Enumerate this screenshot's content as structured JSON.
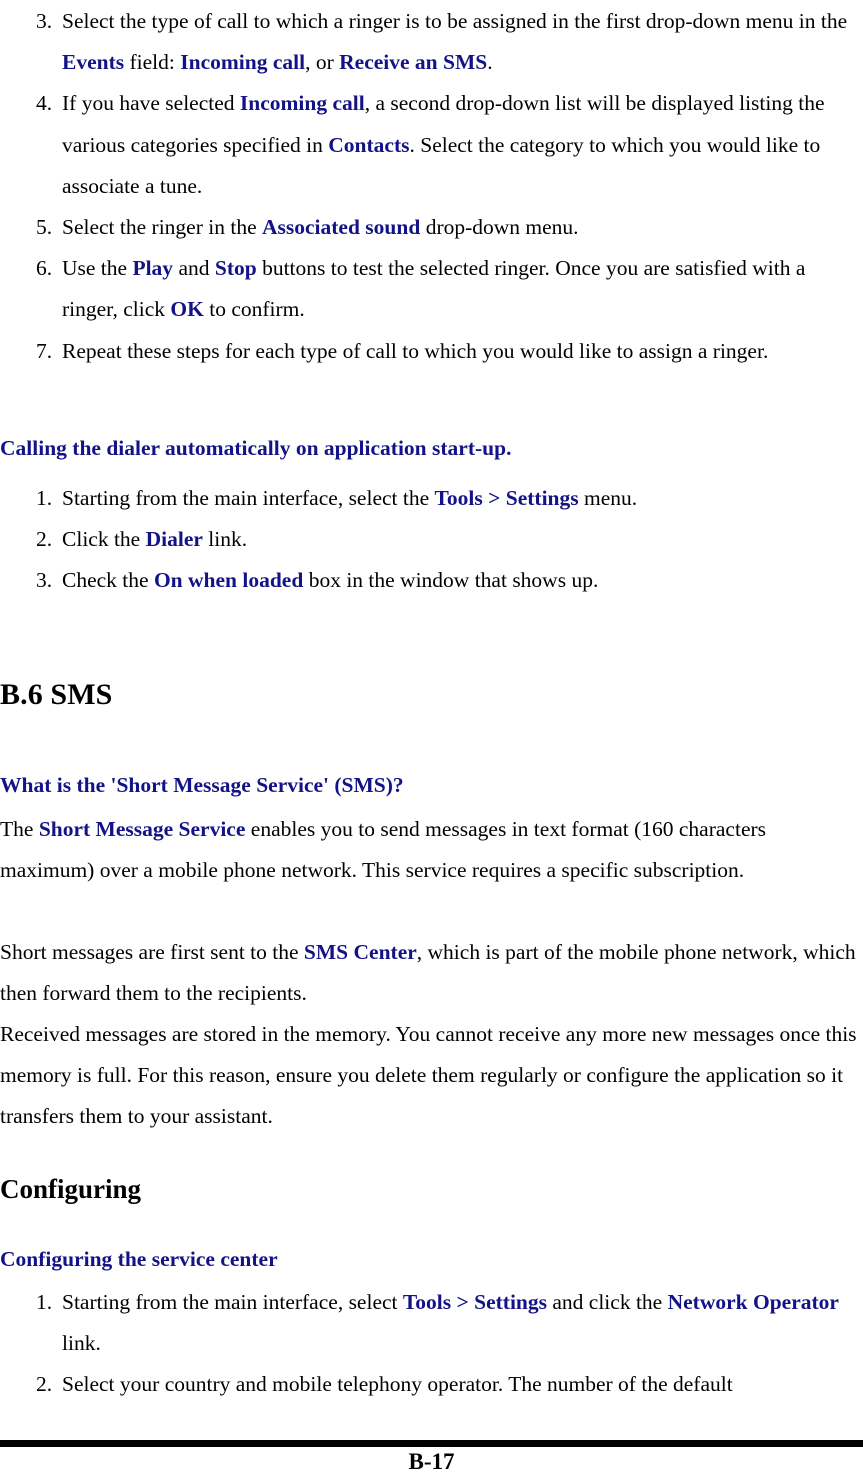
{
  "page": {
    "footer_page_number": "B-17",
    "accent_color": "#131387",
    "text_color": "#000000",
    "background_color": "#ffffff"
  },
  "ringer_steps": {
    "items": [
      {
        "number": "3.",
        "runs": [
          {
            "t": "Select the type of call to which a ringer is to be assigned in the first drop-down menu in the ",
            "s": "plain"
          },
          {
            "t": "Events",
            "s": "bold-blue"
          },
          {
            "t": " field: ",
            "s": "plain"
          },
          {
            "t": "Incoming call",
            "s": "bold-blue"
          },
          {
            "t": ", or ",
            "s": "plain"
          },
          {
            "t": "Receive an SMS",
            "s": "bold-blue"
          },
          {
            "t": ".",
            "s": "plain"
          }
        ]
      },
      {
        "number": "4.",
        "runs": [
          {
            "t": "If you have selected ",
            "s": "plain"
          },
          {
            "t": "Incoming call",
            "s": "bold-blue"
          },
          {
            "t": ", a second drop-down list will be displayed listing the various categories specified in ",
            "s": "plain"
          },
          {
            "t": "Contacts",
            "s": "bold-blue"
          },
          {
            "t": ". Select the category to which you would like to associate a tune.",
            "s": "plain"
          }
        ]
      },
      {
        "number": "5.",
        "runs": [
          {
            "t": "Select the ringer in the ",
            "s": "plain"
          },
          {
            "t": "Associated sound",
            "s": "bold-blue"
          },
          {
            "t": " drop-down menu.",
            "s": "plain"
          }
        ]
      },
      {
        "number": "6.",
        "runs": [
          {
            "t": "Use the ",
            "s": "plain"
          },
          {
            "t": "Play",
            "s": "bold-blue"
          },
          {
            "t": " and ",
            "s": "plain"
          },
          {
            "t": "Stop",
            "s": "bold-blue"
          },
          {
            "t": " buttons to test the selected ringer. Once you are satisfied with a ringer, click ",
            "s": "plain"
          },
          {
            "t": "OK",
            "s": "bold-blue"
          },
          {
            "t": " to confirm.",
            "s": "plain"
          }
        ]
      },
      {
        "number": "7.",
        "runs": [
          {
            "t": "Repeat these steps for each type of call to which you would like to assign a ringer.",
            "s": "plain"
          }
        ]
      }
    ]
  },
  "dialer_heading": {
    "runs": [
      {
        "t": "Calling the dialer automatically on application start-up",
        "s": "bold-blue"
      },
      {
        "t": ".",
        "s": "bold-black"
      }
    ]
  },
  "dialer_steps": {
    "items": [
      {
        "number": "1.",
        "runs": [
          {
            "t": "Starting from the main interface, select the ",
            "s": "plain"
          },
          {
            "t": "Tools",
            "s": "bold-blue"
          },
          {
            "t": " > ",
            "s": "bold-blue"
          },
          {
            "t": "Settings",
            "s": "bold-blue"
          },
          {
            "t": " menu.",
            "s": "plain"
          }
        ]
      },
      {
        "number": "2.",
        "runs": [
          {
            "t": "Click the ",
            "s": "plain"
          },
          {
            "t": "Dialer",
            "s": "bold-blue"
          },
          {
            "t": " link.",
            "s": "plain"
          }
        ]
      },
      {
        "number": "3.",
        "runs": [
          {
            "t": "Check the ",
            "s": "plain"
          },
          {
            "t": "On when loaded",
            "s": "bold-blue"
          },
          {
            "t": " box in the window that shows up.",
            "s": "plain"
          }
        ]
      }
    ]
  },
  "sms_section": {
    "heading": "B.6 SMS",
    "question_heading": "What is the 'Short Message Service' (SMS)?",
    "paragraph_1": {
      "runs": [
        {
          "t": "The ",
          "s": "plain"
        },
        {
          "t": "Short Message Service",
          "s": "bold-blue"
        },
        {
          "t": " enables you to send messages in text format (160 characters maximum) over a mobile phone network. This service requires a specific subscription.",
          "s": "plain"
        }
      ]
    },
    "paragraph_2": {
      "runs": [
        {
          "t": "Short messages are first sent to the ",
          "s": "plain"
        },
        {
          "t": "SMS Center",
          "s": "bold-blue"
        },
        {
          "t": ", which is part of the mobile phone network, which then forward them to the recipients.",
          "s": "plain"
        }
      ]
    },
    "paragraph_3": {
      "runs": [
        {
          "t": "Received messages are stored in the memory. You cannot receive any more new messages once this memory is full. For this reason, ensure you delete them regularly or configure the application so it transfers them to your assistant.",
          "s": "plain"
        }
      ]
    }
  },
  "configuring_section": {
    "heading": "Configuring",
    "sub_heading": "Configuring the service center",
    "steps": [
      {
        "number": "1.",
        "runs": [
          {
            "t": "Starting from the main interface, select ",
            "s": "plain"
          },
          {
            "t": "Tools",
            "s": "bold-blue"
          },
          {
            "t": " > ",
            "s": "bold-blue"
          },
          {
            "t": "Settings",
            "s": "bold-blue"
          },
          {
            "t": " and click the ",
            "s": "plain"
          },
          {
            "t": "Network Operator",
            "s": "bold-blue"
          },
          {
            "t": " link.",
            "s": "plain"
          }
        ]
      },
      {
        "number": "2.",
        "runs": [
          {
            "t": "Select your country and mobile telephony operator. The number of the default",
            "s": "plain"
          }
        ]
      }
    ]
  }
}
